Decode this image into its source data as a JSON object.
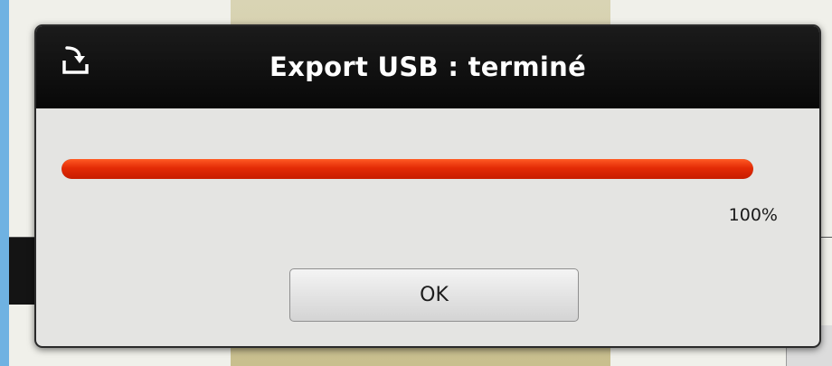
{
  "dialog": {
    "title": "Export USB : terminé",
    "title_icon": "usb-export-icon",
    "progress": {
      "fraction": 1.0,
      "label": "100%",
      "fill_color": "#e32b06"
    },
    "ok_label": "OK"
  },
  "colors": {
    "desktop_background": "#6fb2e2",
    "titlebar": "#0d0d0d",
    "dialog_body": "#e4e4e2"
  }
}
